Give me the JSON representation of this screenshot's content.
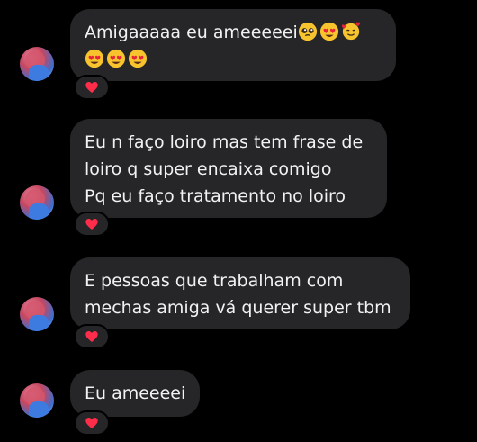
{
  "messages": [
    {
      "lines": [
        "Amigaaaaa eu ameeeeei"
      ],
      "emoji_line_1": [
        "pleading-face",
        "heart-eyes-face",
        "smiling-face-with-hearts"
      ],
      "emoji_line_2": [
        "heart-eyes-face",
        "heart-eyes-face",
        "heart-eyes-face"
      ],
      "reaction": "heart"
    },
    {
      "lines": [
        "Eu n faço loiro mas tem frase de",
        "loiro q super encaixa comigo",
        "Pq eu faço tratamento no loiro"
      ],
      "reaction": "heart"
    },
    {
      "lines": [
        "E pessoas que trabalham com",
        "mechas amiga vá querer super tbm"
      ],
      "reaction": "heart"
    },
    {
      "lines": [
        "Eu ameeeei"
      ],
      "reaction": "heart"
    }
  ],
  "colors": {
    "background": "#000000",
    "bubble": "#262629",
    "text": "#f2f2f2",
    "heart": "#ff2d4a"
  }
}
